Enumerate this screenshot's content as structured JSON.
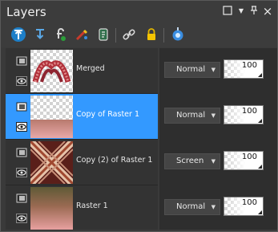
{
  "panel": {
    "title": "Layers"
  },
  "toolbar": {
    "tools": [
      "move-layer-up-icon",
      "move-layer-down-icon",
      "new-layer-icon",
      "delete-layer-icon",
      "duplicate-layer-icon",
      "link-icon",
      "lock-icon",
      "visibility-toggle-icon"
    ]
  },
  "layers": [
    {
      "name": "Merged",
      "blend_mode": "Normal",
      "opacity": "100",
      "selected": false
    },
    {
      "name": "Copy of Raster 1",
      "blend_mode": "Normal",
      "opacity": "100",
      "selected": true
    },
    {
      "name": "Copy (2) of Raster 1",
      "blend_mode": "Screen",
      "opacity": "100",
      "selected": false
    },
    {
      "name": "Raster 1",
      "blend_mode": "Normal",
      "opacity": "100",
      "selected": false
    }
  ],
  "colors": {
    "selection": "#3399ff",
    "panel_bg": "#3a3a3a"
  }
}
